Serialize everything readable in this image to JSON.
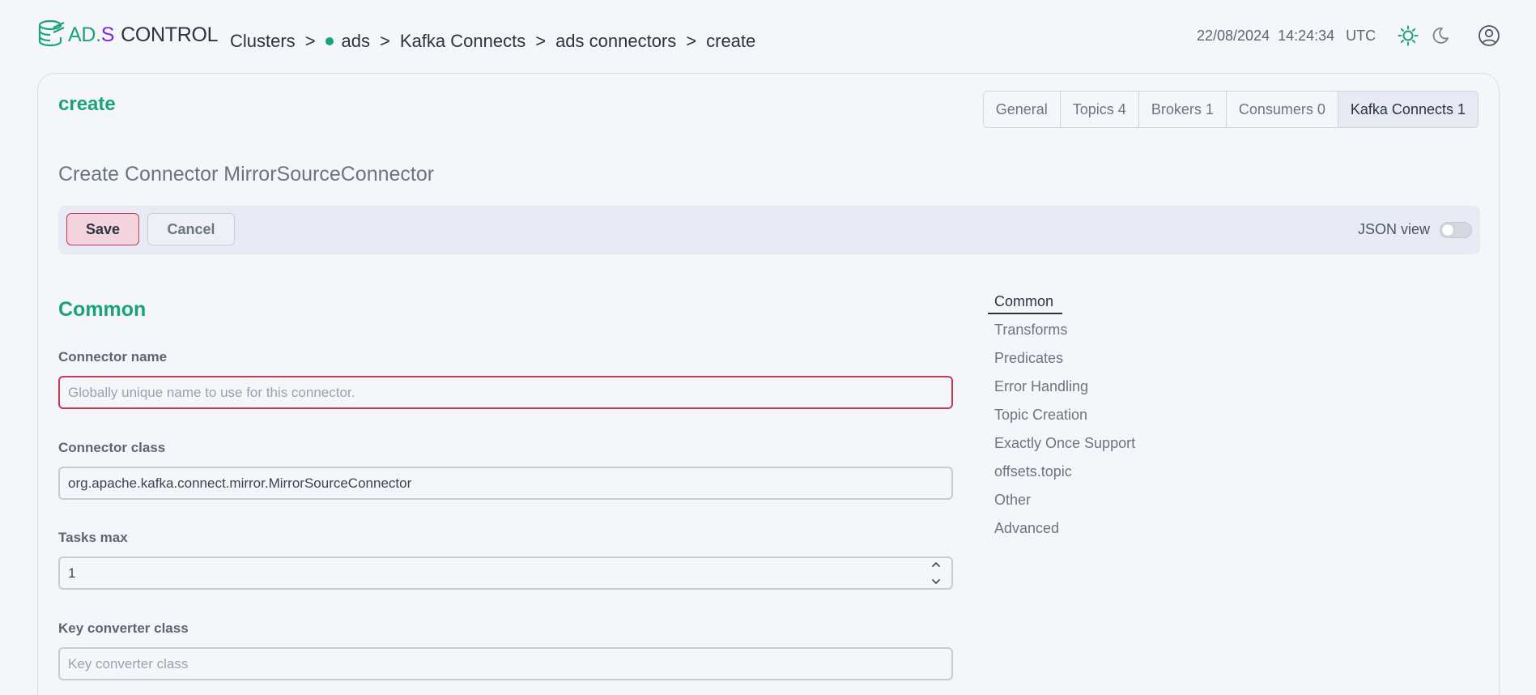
{
  "header": {
    "logo": {
      "ad": "AD.",
      "s": "S",
      "control": "CONTROL"
    },
    "breadcrumb": [
      "Clusters",
      "ads",
      "Kafka Connects",
      "ads connectors",
      "create"
    ],
    "breadcrumb_sep": ">",
    "status_dot_color": "#1aa37a",
    "date": "22/08/2024",
    "time": "14:24:34",
    "timezone": "UTC",
    "icons": [
      "sun-icon",
      "moon-icon",
      "user-icon"
    ]
  },
  "page": {
    "title": "create",
    "tabs": [
      {
        "label": "General"
      },
      {
        "label": "Topics 4"
      },
      {
        "label": "Brokers 1"
      },
      {
        "label": "Consumers 0"
      },
      {
        "label": "Kafka Connects 1",
        "active": true
      }
    ],
    "form_heading": "Create Connector MirrorSourceConnector"
  },
  "toolbar": {
    "save_label": "Save",
    "cancel_label": "Cancel",
    "json_view_label": "JSON view",
    "json_view_on": false
  },
  "form": {
    "section_title": "Common",
    "fields": [
      {
        "label": "Connector name",
        "value": "",
        "placeholder": "Globally unique name to use for this connector."
      },
      {
        "label": "Connector class",
        "value": "org.apache.kafka.connect.mirror.MirrorSourceConnector",
        "placeholder": ""
      },
      {
        "label": "Tasks max",
        "value": "1",
        "placeholder": ""
      },
      {
        "label": "Key converter class",
        "value": "",
        "placeholder": "Key converter class"
      }
    ]
  },
  "side_nav": {
    "items": [
      "Common",
      "Transforms",
      "Predicates",
      "Error Handling",
      "Topic Creation",
      "Exactly Once Support",
      "offsets.topic",
      "Other",
      "Advanced"
    ],
    "active": "Common"
  },
  "colors": {
    "accent": "#1aa37a",
    "brand_purple": "#7a2ae0",
    "error": "#c9375a"
  }
}
